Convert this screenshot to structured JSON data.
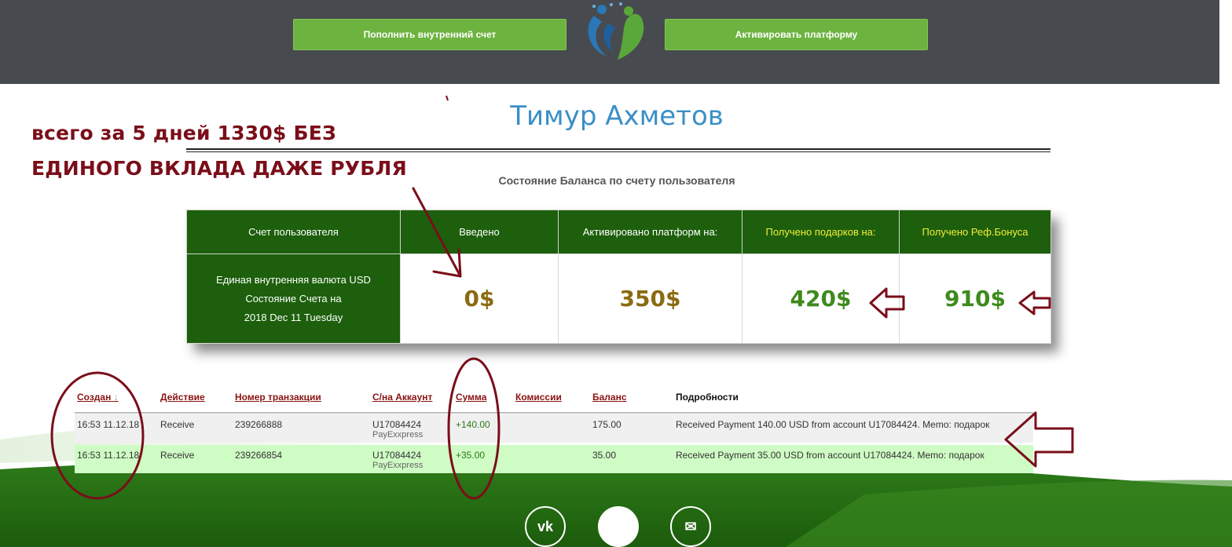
{
  "header": {
    "left_button": "Пополнить внутренний счет",
    "right_button": "Активировать платформу"
  },
  "profile": {
    "name": "Тимур Ахметов",
    "subtitle": "Состояние Баланса по счету пользователя"
  },
  "promo": {
    "line1": "всего за 5 дней 1330$ БЕЗ",
    "line2": "ЕДИНОГО ВКЛАДА ДАЖЕ РУБЛЯ"
  },
  "balance": {
    "headers": [
      "Счет пользователя",
      "Введено",
      "Активировано платформ на:",
      "Получено подарков на:",
      "Получено Реф.Бонуса"
    ],
    "account_lines": [
      "Единая внутренняя валюта USD",
      "Состояние Счета на",
      "2018 Dec 11 Tuesday"
    ],
    "values": [
      "0$",
      "350$",
      "420$",
      "910$"
    ]
  },
  "transactions": {
    "headers": [
      "Создан",
      "Действие",
      "Номер транзакции",
      "С/на Аккаунт",
      "Сумма",
      "Комиссии",
      "Баланс",
      "Подробности"
    ],
    "sort_indicator": "↓",
    "rows": [
      {
        "created": "16:53 11.12.18",
        "action": "Receive",
        "txn": "239266888",
        "account": "U17084424",
        "system": "PayExxpress",
        "amount": "+140.00",
        "fee": "",
        "balance": "175.00",
        "details": "Received Payment 140.00 USD from account U17084424. Memo: подарок"
      },
      {
        "created": "16:53 11.12.18",
        "action": "Receive",
        "txn": "239266854",
        "account": "U17084424",
        "system": "PayExxpress",
        "amount": "+35.00",
        "fee": "",
        "balance": "35.00",
        "details": "Received Payment 35.00 USD from account U17084424. Memo: подарок"
      }
    ]
  },
  "social": {
    "vk_label": "vk",
    "mail_label": "✉"
  },
  "colors": {
    "header_bg": "#474b4f",
    "button_green": "#6db33f",
    "table_green": "#1d5f0c",
    "annotation_red": "#7a0e1a",
    "title_blue": "#3b8fc7"
  }
}
